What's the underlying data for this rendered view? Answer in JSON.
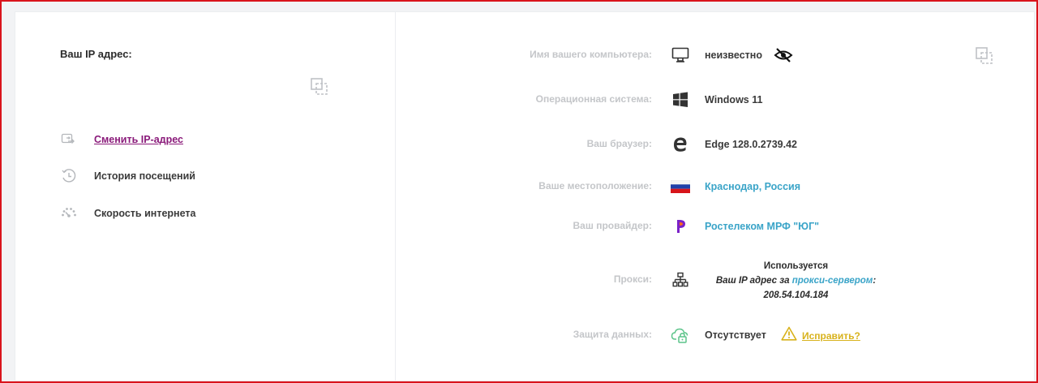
{
  "left": {
    "ip_label": "Ваш IP адрес:",
    "menu": [
      {
        "label": "Сменить IP-адрес",
        "icon": "swap-arrows-icon",
        "link": true
      },
      {
        "label": "История посещений",
        "icon": "history-clock-icon",
        "link": false
      },
      {
        "label": "Скорость интернета",
        "icon": "speedometer-icon",
        "link": false
      }
    ]
  },
  "right": {
    "computer": {
      "label": "Имя вашего компьютера:",
      "value": "неизвестно",
      "icon": "monitor-icon"
    },
    "os": {
      "label": "Операционная система:",
      "value": "Windows 11",
      "icon": "windows-logo-icon"
    },
    "browser": {
      "label": "Ваш браузер:",
      "value": "Edge 128.0.2739.42",
      "icon": "edge-logo-icon"
    },
    "location": {
      "label": "Ваше местоположение:",
      "value": "Краснодар, Россия",
      "icon": "russia-flag-icon"
    },
    "provider": {
      "label": "Ваш провайдер:",
      "value": "Ростелеком МРФ \"ЮГ\"",
      "icon": "rostelecom-logo-icon"
    },
    "proxy": {
      "label": "Прокси:",
      "status": "Используется",
      "line2_prefix": "Ваш IP адрес за ",
      "line2_link": "прокси-сервером",
      "line2_suffix": ":",
      "ip": "208.54.104.184",
      "icon": "network-hierarchy-icon"
    },
    "protection": {
      "label": "Защита данных:",
      "value": "Отсутствует",
      "fix_label": "Исправить?",
      "icon": "cloud-lock-icon"
    }
  },
  "colors": {
    "frame": "#d9141c",
    "link_purple": "#8a1a7a",
    "value_blue": "#3aa4c8",
    "warning_yellow": "#d8b21c",
    "label_gray": "#c4c6c9",
    "cloud_green": "#5cc48a"
  }
}
